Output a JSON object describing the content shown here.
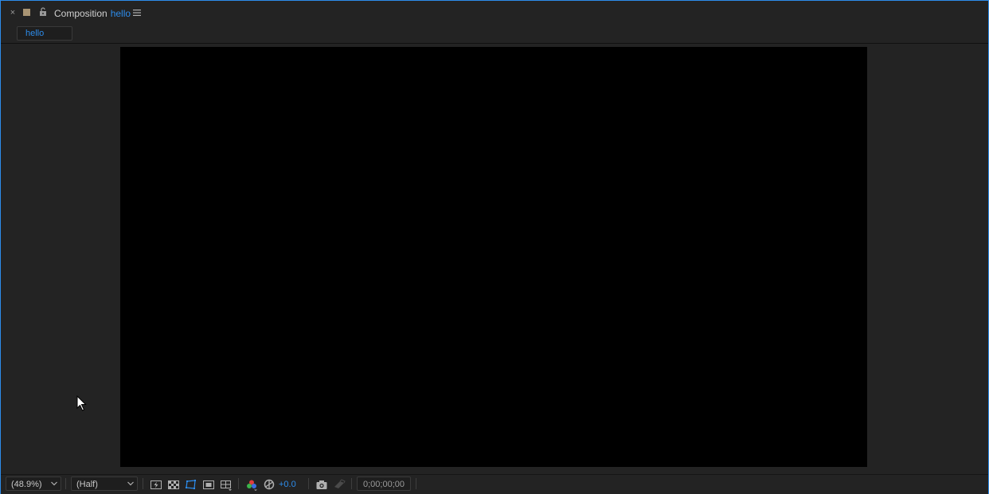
{
  "panel": {
    "close_glyph": "×",
    "label_color": "#a89473",
    "title_prefix": "Composition",
    "comp_name": "hello",
    "menu_icon": "hamburger-menu-icon",
    "lock_icon": "lock-icon"
  },
  "tabs": [
    {
      "label": "hello"
    }
  ],
  "viewer": {
    "background": "#000000"
  },
  "toolbar": {
    "magnification": "(48.9%)",
    "resolution": "(Half)",
    "exposure": "+0.0",
    "timecode": "0;00;00;00",
    "icons": [
      "fast-previews-icon",
      "transparency-grid-icon",
      "mask-path-visibility-icon",
      "region-of-interest-icon",
      "grid-guides-icon",
      "color-channels-icon",
      "reset-exposure-icon",
      "snapshot-icon",
      "show-snapshot-icon"
    ]
  },
  "colors": {
    "accent": "#2d8ceb",
    "panel_bg": "#232323",
    "text": "#d0d0d0"
  }
}
